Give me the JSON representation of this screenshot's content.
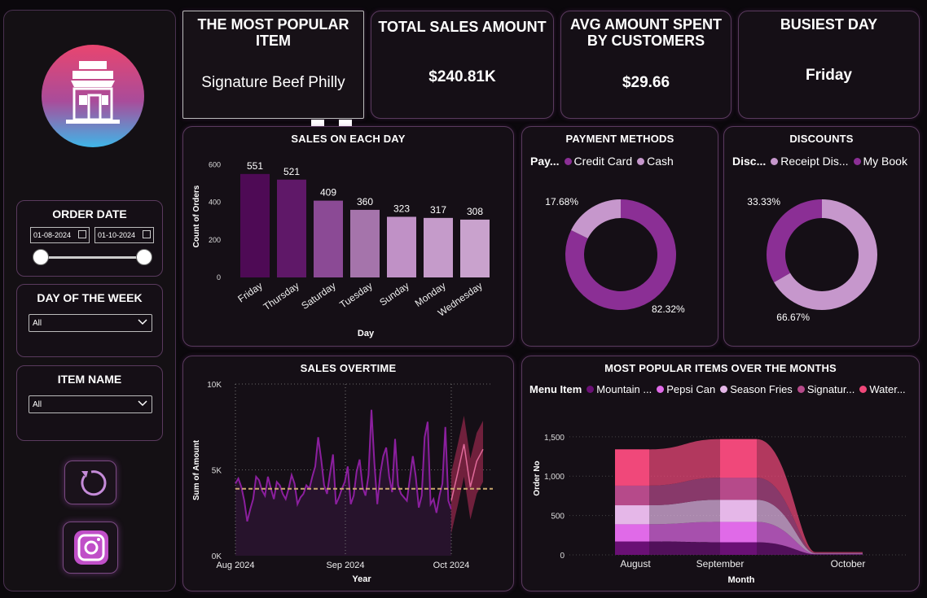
{
  "sidebar": {
    "order_date": {
      "title": "ORDER DATE",
      "start": "01-08-2024",
      "end": "01-10-2024"
    },
    "day_of_week": {
      "title": "DAY OF THE WEEK",
      "value": "All"
    },
    "item_name": {
      "title": "ITEM NAME",
      "value": "All"
    }
  },
  "kpis": {
    "popular_item": {
      "title": "THE MOST POPULAR ITEM",
      "value": "Signature Beef Philly"
    },
    "total_sales": {
      "title": "TOTAL SALES AMOUNT",
      "value": "$240.81K"
    },
    "avg_spent": {
      "title": "AVG AMOUNT SPENT BY CUSTOMERS",
      "value": "$29.66"
    },
    "busiest_day": {
      "title": "BUSIEST DAY",
      "value": "Friday"
    }
  },
  "colors": {
    "dark_purple": "#4e0a55",
    "mid_purple": "#8b3a96",
    "light_purple": "#c08ac7",
    "pink": "#f0487a",
    "magenta": "#e06ae8"
  },
  "chart_data": [
    {
      "type": "bar",
      "title": "SALES ON EACH DAY",
      "xlabel": "Day",
      "ylabel": "Count of Orders",
      "categories": [
        "Friday",
        "Thursday",
        "Saturday",
        "Tuesday",
        "Sunday",
        "Monday",
        "Wednesday"
      ],
      "values": [
        551,
        521,
        409,
        360,
        323,
        317,
        308
      ],
      "yticks": [
        "0",
        "200",
        "400",
        "600"
      ],
      "ylim": [
        0,
        650
      ],
      "colors": [
        "#4e0a55",
        "#5f1868",
        "#8b4a95",
        "#a574ab",
        "#c091c6",
        "#c59bca",
        "#c9a2cd"
      ]
    },
    {
      "type": "pie",
      "title": "PAYMENT METHODS",
      "legend_title": "Pay...",
      "labels": [
        "Credit Card",
        "Cash"
      ],
      "values": [
        82.32,
        17.68
      ],
      "value_labels": [
        "82.32%",
        "17.68%"
      ],
      "colors": [
        "#8b2f95",
        "#c697cc"
      ]
    },
    {
      "type": "pie",
      "title": "DISCOUNTS",
      "legend_title": "Disc...",
      "labels": [
        "Receipt Dis...",
        "My Book"
      ],
      "values": [
        66.67,
        33.33
      ],
      "value_labels": [
        "66.67%",
        "33.33%"
      ],
      "colors": [
        "#c697cc",
        "#8b2f95"
      ]
    },
    {
      "type": "line",
      "title": "SALES OVERTIME",
      "xlabel": "Year",
      "ylabel": "Sum of Amount",
      "xticks": [
        "Aug 2024",
        "Sep 2024",
        "Oct 2024"
      ],
      "yticks": [
        "0K",
        "5K",
        "10K"
      ],
      "ylim": [
        0,
        10000
      ],
      "average": 3900,
      "series": [
        {
          "values": [
            4200,
            4500,
            4000,
            3200,
            2000,
            2700,
            3300,
            4600,
            4400,
            3800,
            3500,
            4600,
            3900,
            3300,
            4300,
            4100,
            3600,
            3300,
            3900,
            4700,
            4200,
            3000,
            3400,
            3600,
            4100,
            3900,
            4600,
            5200,
            6900,
            5600,
            4100,
            3600,
            4800,
            5900,
            3000,
            3400,
            3900,
            4300,
            5200,
            3000,
            3500,
            4900,
            5600,
            4000,
            3500,
            4700,
            8500,
            5400,
            3000,
            4800,
            5800,
            6300,
            4600,
            3700,
            6800,
            4100,
            3600,
            3400,
            3200,
            4500,
            5800,
            4600,
            2800,
            3500,
            6900,
            7800,
            3000,
            3300,
            2500,
            3500,
            4200,
            7500,
            3200,
            2700
          ]
        },
        {
          "name": "forecast",
          "values": [
            3200,
            4800,
            6500,
            4000,
            5500,
            6200
          ]
        }
      ]
    },
    {
      "type": "area",
      "title": "MOST POPULAR ITEMS OVER THE MONTHS",
      "legend_title": "Menu Item",
      "xlabel": "Month",
      "ylabel": "Order No",
      "categories": [
        "August",
        "September",
        "October"
      ],
      "yticks": [
        "0",
        "500",
        "1,000",
        "1,500"
      ],
      "ylim": [
        0,
        1550
      ],
      "series": [
        {
          "name": "Mountain ...",
          "values": [
            170,
            160,
            8
          ]
        },
        {
          "name": "Pepsi Can",
          "values": [
            220,
            260,
            6
          ]
        },
        {
          "name": "Season Fries",
          "values": [
            240,
            280,
            6
          ]
        },
        {
          "name": "Signatur...",
          "values": [
            250,
            280,
            6
          ]
        },
        {
          "name": "Water...",
          "values": [
            460,
            490,
            9
          ]
        }
      ],
      "colors": [
        "#6a1075",
        "#e06ae8",
        "#e5b7e8",
        "#b64a8a",
        "#f0487a"
      ]
    }
  ]
}
